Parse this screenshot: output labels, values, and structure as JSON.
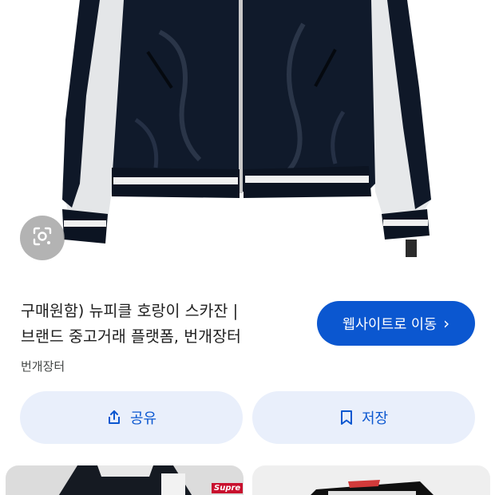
{
  "result": {
    "title_line1": "구매원함) 뉴피클 호랑이 스카잔 |",
    "title_line2": "브랜드 중고거래 플랫폼, 번개장터",
    "source": "번개장터"
  },
  "actions": {
    "visit_label": "웹사이트로 이동",
    "visit_chevron": "›",
    "share_label": "공유",
    "save_label": "저장"
  },
  "related": {
    "brand_tag": "Supre"
  },
  "icons": {
    "lens": "google-lens-icon",
    "share": "share-icon",
    "save": "bookmark-icon",
    "chevron": "chevron-right-icon"
  },
  "colors": {
    "accent": "#0b57d0",
    "pill_bg": "#e9effb",
    "text": "#1f1f1f",
    "muted": "#444746"
  }
}
